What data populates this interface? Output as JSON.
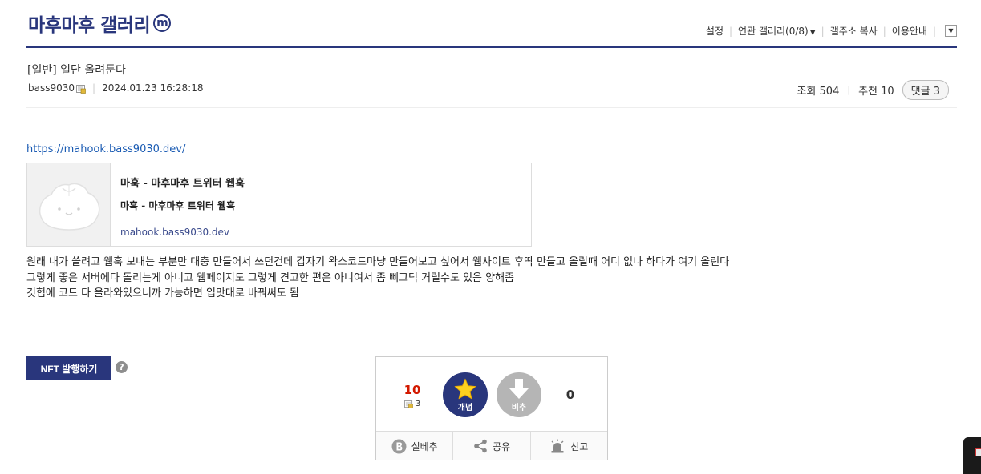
{
  "gallery": {
    "title": "마후마후 갤러리",
    "minor_badge": "m"
  },
  "top_links": {
    "settings": "설정",
    "related": "연관 갤러리(0/8)",
    "copy_address": "갤주소 복사",
    "guide": "이용안내"
  },
  "post": {
    "title": "[일반] 일단 올려둔다",
    "author": "bass9030",
    "date": "2024.01.23 16:28:18",
    "views_label": "조회 504",
    "recommend_label": "추천 10",
    "comments_label": "댓글 3",
    "link": "https://mahook.bass9030.dev/",
    "preview": {
      "title": "마훅 - 마후마후 트위터 웹훅",
      "description": "마훅 - 마후마후 트위터 웹훅",
      "domain": "mahook.bass9030.dev"
    },
    "body_lines": [
      "원래 내가 쓸려고 웹훅 보내는 부분만 대충 만들어서 쓰던건데 갑자기 왁스코드마냥 만들어보고 싶어서 웹사이트 후딱 만들고 올릴때 어디 없나 하다가 여기 올린다",
      "그렇게 좋은 서버에다 돌리는게 아니고 웹페이지도 그렇게 견고한 편은 아니여서 좀 삐그덕 거릴수도 있음 양해좀",
      "깃헙에 코드 다 올라와있으니까 가능하면 입맛대로 바꿔써도 됨"
    ]
  },
  "nft_button": "NFT 발행하기",
  "help_mark": "?",
  "vote": {
    "up_count": "10",
    "fix_count": "3",
    "up_label": "개념",
    "down_label": "비추",
    "down_count": "0",
    "actions": {
      "silbechu": "실베추",
      "share": "공유",
      "report": "신고"
    }
  },
  "colors": {
    "brand": "#29367c",
    "link": "#1a5bb3",
    "recommend": "#d31900"
  }
}
